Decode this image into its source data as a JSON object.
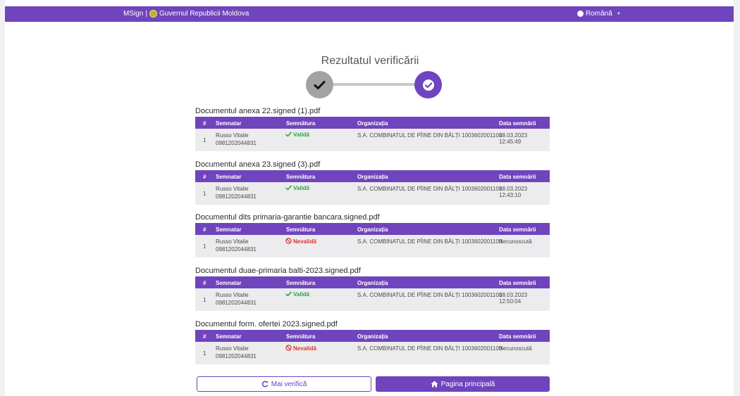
{
  "header": {
    "brand": "MSign",
    "separator": "|",
    "gov": "Guvernul Republicii Moldova",
    "language": "Română",
    "caret_icon": "caret-down-icon",
    "color": "#6f44bd"
  },
  "page": {
    "title": "Rezultatul verificării",
    "step_done_icon": "check-icon",
    "step_current_icon": "check-circle-icon"
  },
  "table_headers": {
    "num": "#",
    "signer": "Semnatar",
    "signature": "Semnătura",
    "org": "Organizația",
    "date": "Data semnării"
  },
  "documents": [
    {
      "name": "Documentul anexa 22.signed (1).pdf",
      "rows": [
        {
          "num": "1",
          "signer": "Russo Vitalie",
          "idnp": "0981202044831",
          "status": "Validă",
          "valid": true,
          "org": "S.A. COMBINATUL DE PÎINE DIN BĂLȚI 1003602001100",
          "date": "18.03.2023 12:45:49"
        }
      ]
    },
    {
      "name": "Documentul anexa 23.signed (3).pdf",
      "rows": [
        {
          "num": "1",
          "signer": "Russo Vitalie",
          "idnp": "0981202044831",
          "status": "Validă",
          "valid": true,
          "org": "S.A. COMBINATUL DE PÎINE DIN BĂLȚI 1003602001100",
          "date": "18.03.2023 12:43:10"
        }
      ]
    },
    {
      "name": "Documentul dits primaria-garantie bancara.signed.pdf",
      "rows": [
        {
          "num": "1",
          "signer": "Russo Vitalie",
          "idnp": "0981202044831",
          "status": "Nevalidă",
          "valid": false,
          "org": "S.A. COMBINATUL DE PÎINE DIN BĂLȚI 1003602001100",
          "date": "Necunoscută"
        }
      ]
    },
    {
      "name": "Documentul duae-primaria balti-2023.signed.pdf",
      "rows": [
        {
          "num": "1",
          "signer": "Russo Vitalie",
          "idnp": "0981202044831",
          "status": "Validă",
          "valid": true,
          "org": "S.A. COMBINATUL DE PÎINE DIN BĂLȚI 1003602001100",
          "date": "18.03.2023 12:50:04"
        }
      ]
    },
    {
      "name": "Documentul form. ofertei 2023.signed.pdf",
      "rows": [
        {
          "num": "1",
          "signer": "Russo Vitalie",
          "idnp": "0981202044831",
          "status": "Nevalidă",
          "valid": false,
          "org": "S.A. COMBINATUL DE PÎINE DIN BĂLȚI 1003602001100",
          "date": "Necunoscută"
        }
      ]
    }
  ],
  "actions": {
    "check_again": "Mai verifică",
    "check_again_icon": "refresh-icon",
    "home": "Pagina principală",
    "home_icon": "home-icon"
  },
  "colors": {
    "valid": "#27a744",
    "invalid": "#e0302a",
    "accent": "#6f44bd"
  }
}
